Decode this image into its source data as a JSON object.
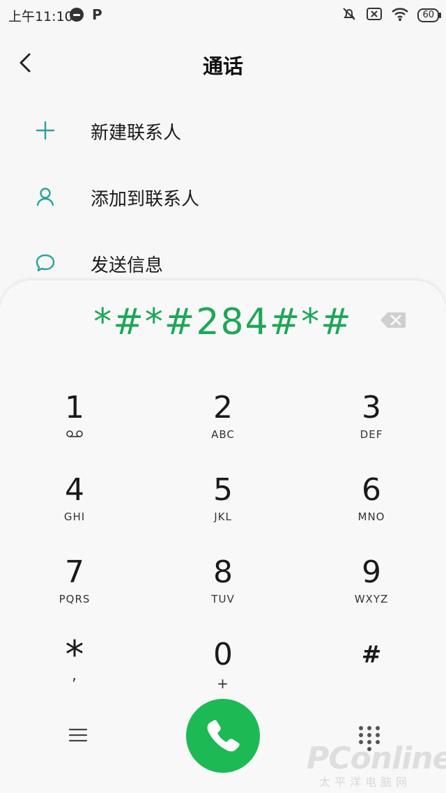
{
  "status_bar": {
    "time": "上午11:10",
    "battery": "60"
  },
  "header": {
    "title": "通话"
  },
  "menu": [
    {
      "label": "新建联系人",
      "icon": "plus-icon"
    },
    {
      "label": "添加到联系人",
      "icon": "person-icon"
    },
    {
      "label": "发送信息",
      "icon": "message-icon"
    }
  ],
  "dialer": {
    "number": "*#*#284#*#",
    "keys": [
      {
        "digit": "1",
        "letters": ""
      },
      {
        "digit": "2",
        "letters": "ABC"
      },
      {
        "digit": "3",
        "letters": "DEF"
      },
      {
        "digit": "4",
        "letters": "GHI"
      },
      {
        "digit": "5",
        "letters": "JKL"
      },
      {
        "digit": "6",
        "letters": "MNO"
      },
      {
        "digit": "7",
        "letters": "PQRS"
      },
      {
        "digit": "8",
        "letters": "TUV"
      },
      {
        "digit": "9",
        "letters": "WXYZ"
      },
      {
        "digit": "*",
        "letters": ","
      },
      {
        "digit": "0",
        "letters": "+"
      },
      {
        "digit": "#",
        "letters": ""
      }
    ]
  },
  "colors": {
    "accent": "#1db954",
    "number_text": "#1ea757",
    "icon_teal": "#2aa19a"
  },
  "watermark": {
    "text": "PConline",
    "sub": "太平洋电脑网"
  }
}
